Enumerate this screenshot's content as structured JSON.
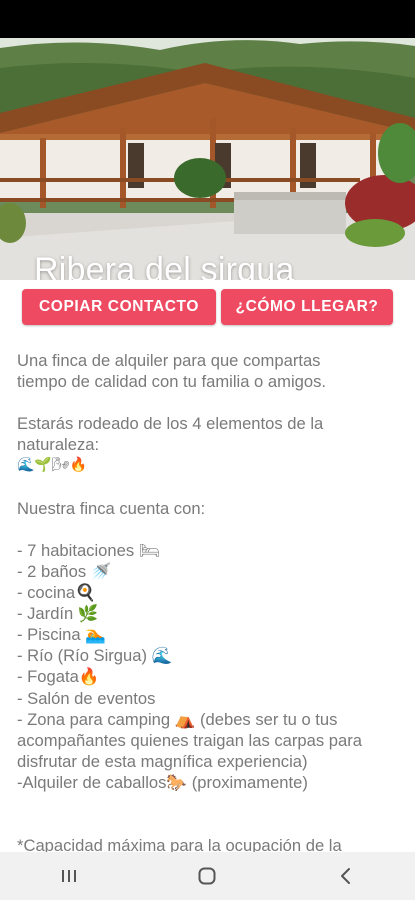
{
  "hero": {
    "title": "Ribera del sirgua"
  },
  "actions": {
    "copy_contact": "COPIAR CONTACTO",
    "directions": "¿CÓMO LLEGAR?"
  },
  "description": {
    "intro_1": "Una finca de alquiler para que compartas",
    "intro_2": "tiempo de calidad con tu familia o amigos.",
    "elements_1": "Estarás rodeado de los 4 elementos de la",
    "elements_2": "naturaleza:",
    "elements_icons": "🌊🌱🌬🔥",
    "amenities_heading": "Nuestra finca cuenta con:",
    "amenities": [
      "- 7 habitaciones 🛏",
      "- 2 baños 🚿",
      "- cocina🍳",
      "- Jardín 🌿",
      "- Piscina 🏊",
      "- Río (Río Sirgua) 🌊",
      "- Fogata🔥",
      "- Salón de eventos",
      "- Zona para camping ⛺ (debes ser tu o tus",
      "acompañantes quienes traigan las carpas para",
      "disfrutar de esta magnífica experiencia)",
      "-Alquiler de caballos🐎 (proximamente)"
    ],
    "capacity": "*Capacidad máxima para la ocupación de la"
  },
  "nav": {
    "recents": "recents-icon",
    "home": "home-icon",
    "back": "back-icon"
  }
}
